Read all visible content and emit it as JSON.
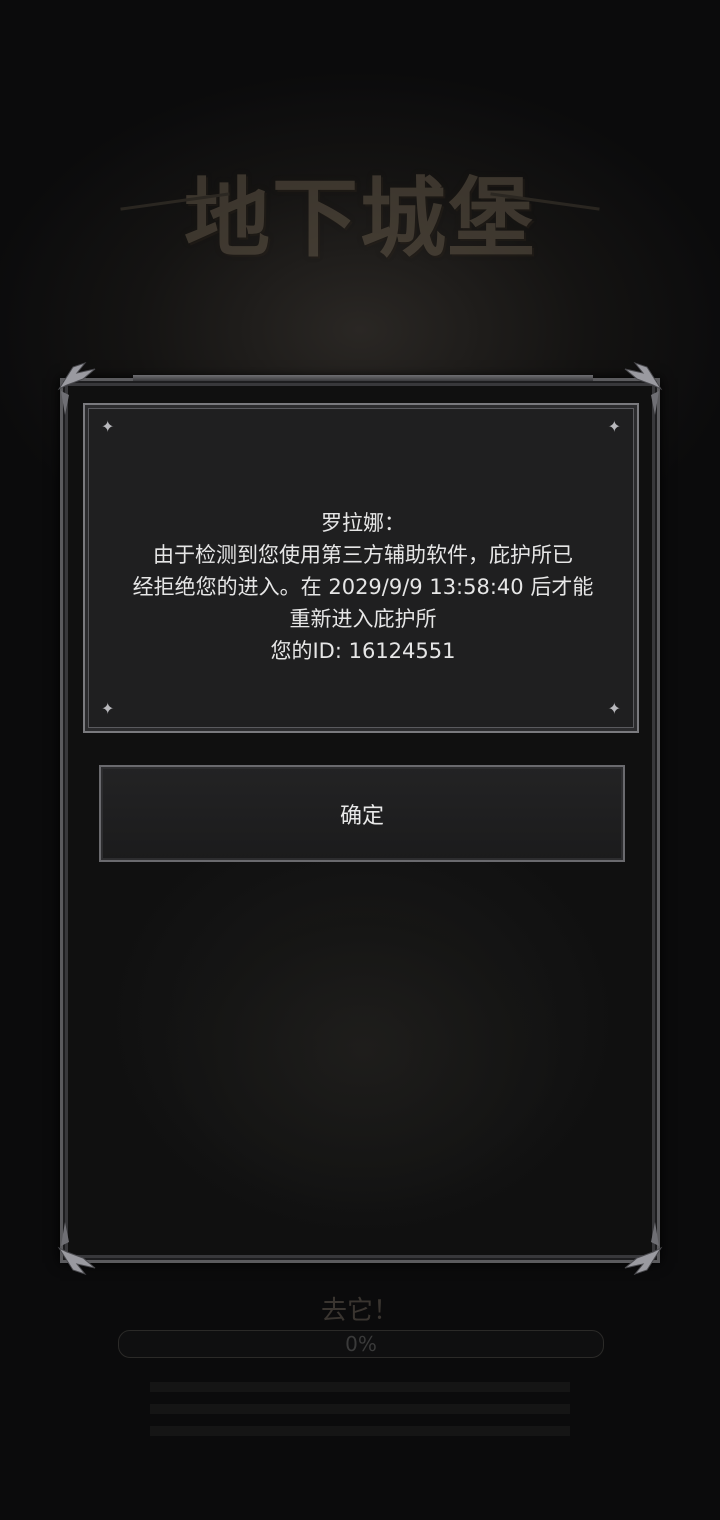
{
  "background": {
    "game_logo": "地下城堡",
    "hint_text": "去它！",
    "progress": {
      "value_percent": 0,
      "label": "0%"
    }
  },
  "dialog": {
    "message_lines": [
      "罗拉娜：",
      "由于检测到您使用第三方辅助软件，庇护所已",
      "经拒绝您的进入。在 2029/9/9 13:58:40 后才能",
      "重新进入庇护所",
      "您的ID: 16124551"
    ],
    "confirm_label": "确定"
  },
  "colors": {
    "frame": "#5b5b5e",
    "panel": "#1f1f20",
    "text": "#e6e6e6"
  }
}
